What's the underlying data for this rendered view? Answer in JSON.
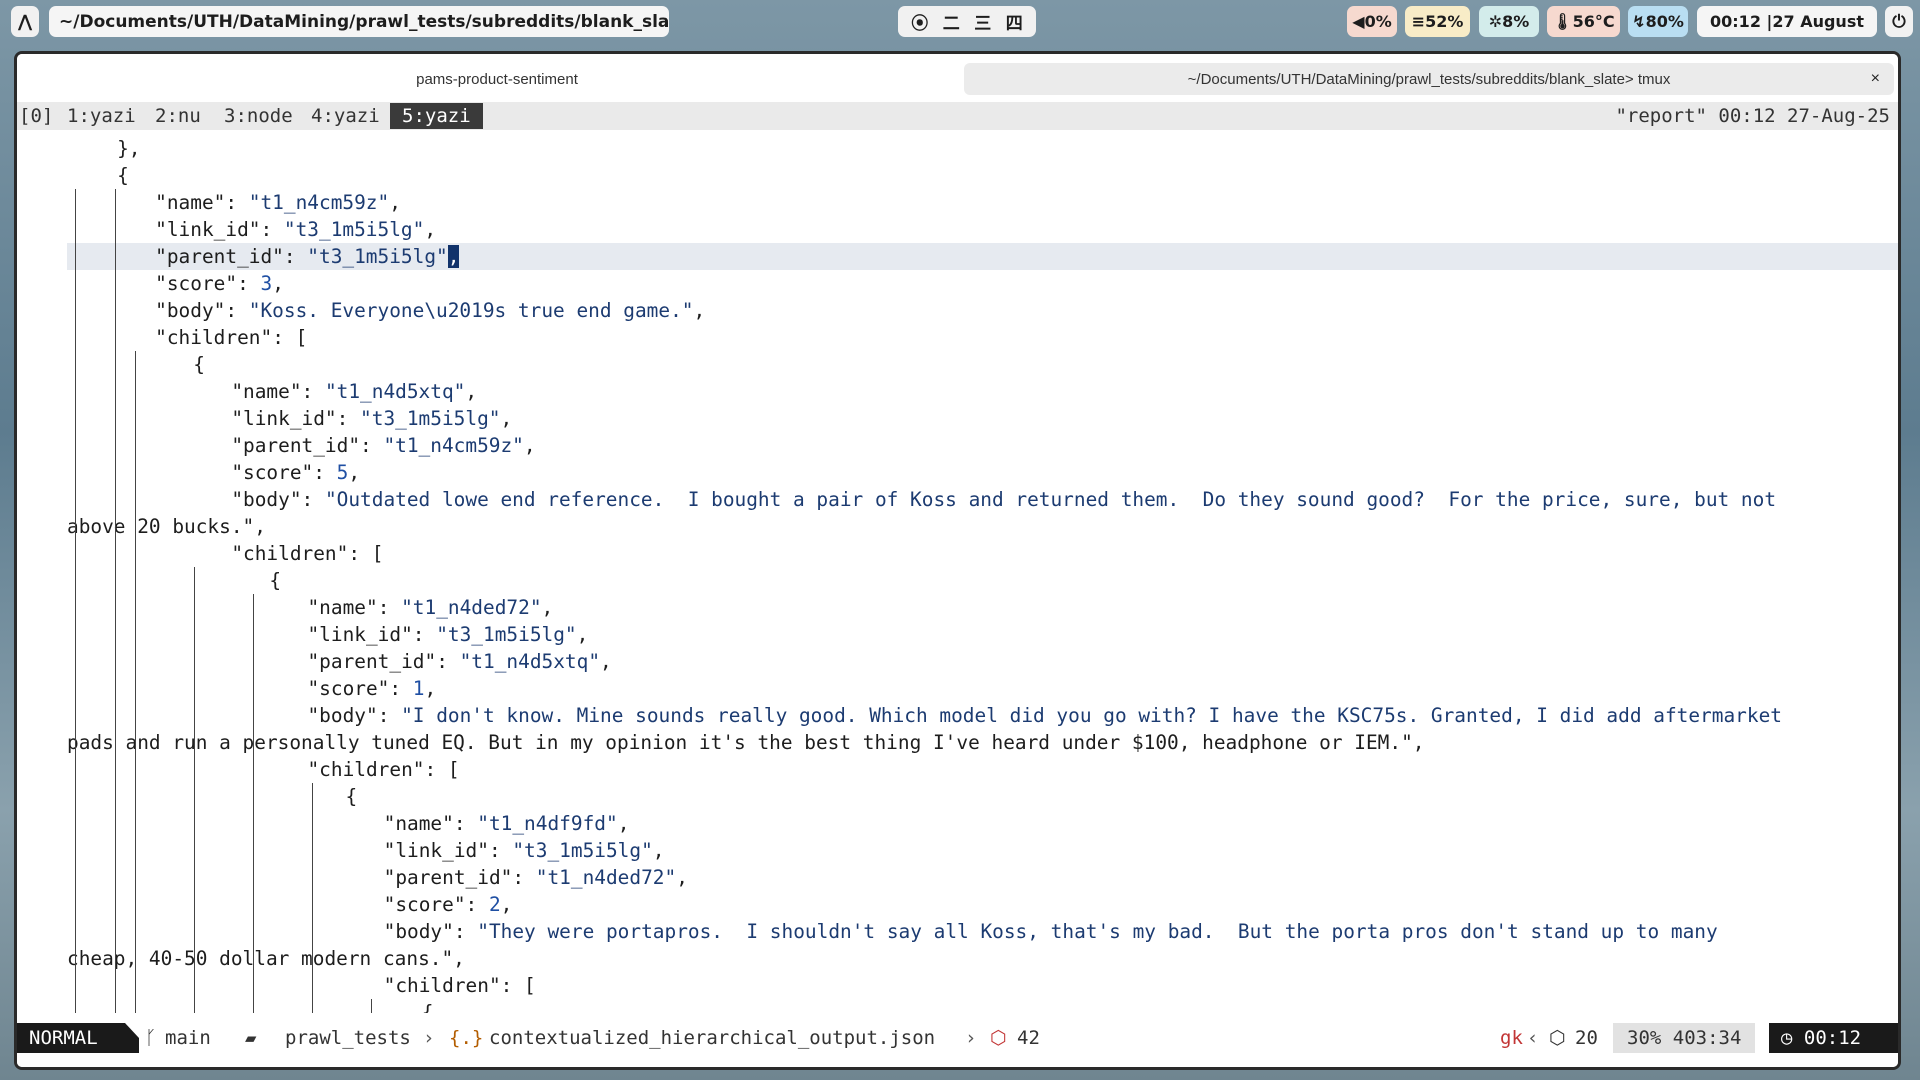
{
  "topbar": {
    "launcher_icon": "arch-logo-icon",
    "path": "~/Documents/UTH/DataMining/prawl_tests/subreddits/blank_sla…",
    "workspaces": [
      "⦿",
      "二",
      "三",
      "四"
    ],
    "volume": "0%",
    "memory": "52%",
    "cpu": "8%",
    "temperature": "56°C",
    "battery": "80%",
    "clock": "00:12 |27 August",
    "power_icon": "power-icon"
  },
  "tabs": {
    "tab1": "pams-product-sentiment",
    "tab2": "~/Documents/UTH/DataMining/prawl_tests/subreddits/blank_slate> tmux",
    "close": "×"
  },
  "tmux": {
    "session": "[0]",
    "windows": [
      "1:yazi",
      "2:nu",
      "3:node",
      "4:yazi",
      "5:yazi"
    ],
    "active_window": "5:yazi",
    "right": "\"report\" 00:12 27-Aug-25"
  },
  "editor_lines": [
    "    },",
    "    {",
    "        \"name\": \"t1_n4cm59z\",",
    "        \"link_id\": \"t3_1m5i5lg\",",
    "        \"parent_id\": \"t3_1m5i5lg\",",
    "        \"score\": 3,",
    "        \"body\": \"Koss. Everyone\\u2019s true end game.\",",
    "        \"children\": [",
    "            {",
    "                \"name\": \"t1_n4d5xtq\",",
    "                \"link_id\": \"t3_1m5i5lg\",",
    "                \"parent_id\": \"t1_n4cm59z\",",
    "                \"score\": 5,",
    "                \"body\": \"Outdated lowe end reference.  I bought a pair of Koss and returned them.  Do they sound good?  For the price, sure, but not",
    "above 20 bucks.\",",
    "                \"children\": [",
    "                    {",
    "                        \"name\": \"t1_n4ded72\",",
    "                        \"link_id\": \"t3_1m5i5lg\",",
    "                        \"parent_id\": \"t1_n4d5xtq\",",
    "                        \"score\": 1,",
    "                        \"body\": \"I don't know. Mine sounds really good. Which model did you go with? I have the KSC75s. Granted, I did add aftermarket",
    "pads and run a personally tuned EQ. But in my opinion it's the best thing I've heard under $100, headphone or IEM.\",",
    "                        \"children\": [",
    "                            {",
    "                                \"name\": \"t1_n4df9fd\",",
    "                                \"link_id\": \"t3_1m5i5lg\",",
    "                                \"parent_id\": \"t1_n4ded72\",",
    "                                \"score\": 2,",
    "                                \"body\": \"They were portapros.  I shouldn't say all Koss, that's my bad.  But the porta pros don't stand up to many",
    "cheap, 40-50 dollar modern cans.\",",
    "                                \"children\": [",
    "                                    {"
  ],
  "status": {
    "mode": "NORMAL",
    "branch_icon": "git-branch-icon",
    "branch": "main",
    "folder_icon": "folder-icon",
    "folder": "prawl_tests",
    "file_icon": "json-braces-icon",
    "file": "contextualized_hierarchical_output.json",
    "box_icon": "package-icon",
    "errors": "42",
    "keys": "gk",
    "lsp_icon": "cube-icon",
    "lsp_count": "20",
    "position": "30% 403:34",
    "clock_icon": "clock-icon",
    "time": "00:12"
  },
  "colors": {
    "cursor": "#12336b",
    "string": "#1c3b71",
    "number": "#1f4fa3",
    "mode_bg": "#1a1a1a"
  }
}
